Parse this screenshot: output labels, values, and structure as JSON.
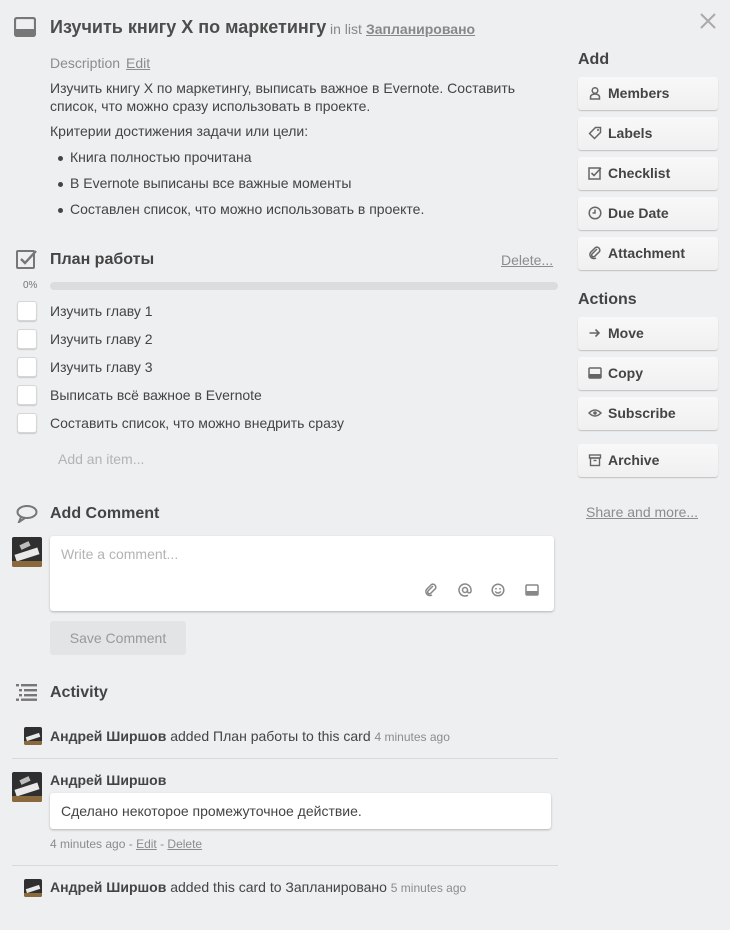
{
  "card": {
    "title": "Изучить книгу X по маркетингу",
    "in_list_prefix": "in list",
    "list_name": "Запланировано"
  },
  "description": {
    "label": "Description",
    "edit_label": "Edit",
    "text": "Изучить книгу X по маркетингу, выписать важное в Evernote. Составить список, что можно сразу использовать в проекте.",
    "criteria_heading": "Критерии достижения задачи или цели:",
    "bullets": [
      "Книга полностью прочитана",
      "В Evernote выписаны все важные моменты",
      "Составлен список, что можно использовать в проекте."
    ]
  },
  "checklist": {
    "title": "План работы",
    "delete_label": "Delete...",
    "progress_label": "0%",
    "progress_fraction": 0,
    "items": [
      "Изучить главу 1",
      "Изучить главу 2",
      "Изучить главу 3",
      "Выписать всё важное в Evernote",
      "Составить список, что можно внедрить сразу"
    ],
    "add_item_placeholder": "Add an item..."
  },
  "comment": {
    "title": "Add Comment",
    "placeholder": "Write a comment...",
    "save_label": "Save Comment"
  },
  "activity": {
    "title": "Activity",
    "entries": [
      {
        "user": "Андрей Ширшов",
        "action": "added План работы to this card",
        "time": "4 minutes ago"
      },
      {
        "user": "Андрей Ширшов",
        "comment": "Сделано некоторое промежуточное действие.",
        "time": "4 minutes ago",
        "edit_label": "Edit",
        "delete_label": "Delete"
      },
      {
        "user": "Андрей Ширшов",
        "action": "added this card to Запланировано",
        "time": "5 minutes ago"
      }
    ]
  },
  "sidebar": {
    "add_heading": "Add",
    "add_buttons": [
      "Members",
      "Labels",
      "Checklist",
      "Due Date",
      "Attachment"
    ],
    "actions_heading": "Actions",
    "action_buttons": [
      "Move",
      "Copy",
      "Subscribe",
      "Archive"
    ],
    "share_label": "Share and more..."
  },
  "colors": {
    "background": "#edeff0",
    "progress_fill": "#5ba4cf"
  }
}
